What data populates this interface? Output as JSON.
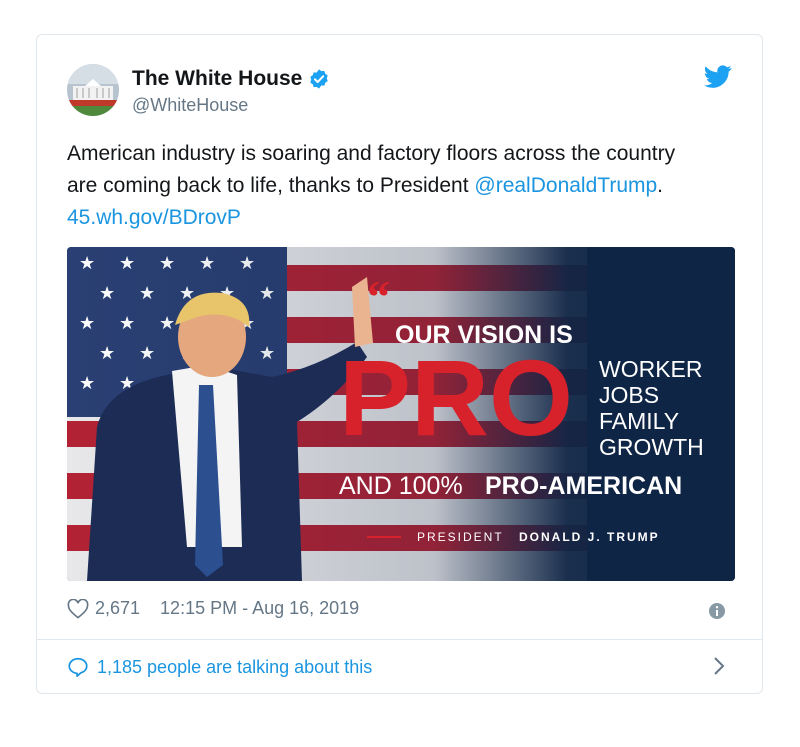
{
  "account": {
    "name": "The White House",
    "handle": "@WhiteHouse"
  },
  "tweet": {
    "text_before": "American industry is soaring and factory floors across the country are coming back to life, thanks to President ",
    "mention": "@realDonaldTrump",
    "text_between": ". ",
    "url": "45.wh.gov/BDrovP"
  },
  "media": {
    "headline": "OUR VISION IS",
    "pro": "PRO",
    "pro_items": [
      "WORKER",
      "JOBS",
      "FAMILY",
      "GROWTH"
    ],
    "bottom_line_prefix": "AND 100%",
    "bottom_line_strong": "PRO-AMERICAN",
    "attribution_prefix": "PRESIDENT",
    "attribution_name": "DONALD J. TRUMP",
    "colors": {
      "navy": "#0f2545",
      "red": "#d8222b"
    }
  },
  "footer": {
    "likes": "2,671",
    "timestamp": "12:15 PM - Aug 16, 2019",
    "talking": "1,185 people are talking about this"
  },
  "icons": [
    "verified-icon",
    "twitter-bird-icon",
    "heart-icon",
    "info-icon",
    "speech-bubble-icon",
    "chevron-right-icon"
  ]
}
